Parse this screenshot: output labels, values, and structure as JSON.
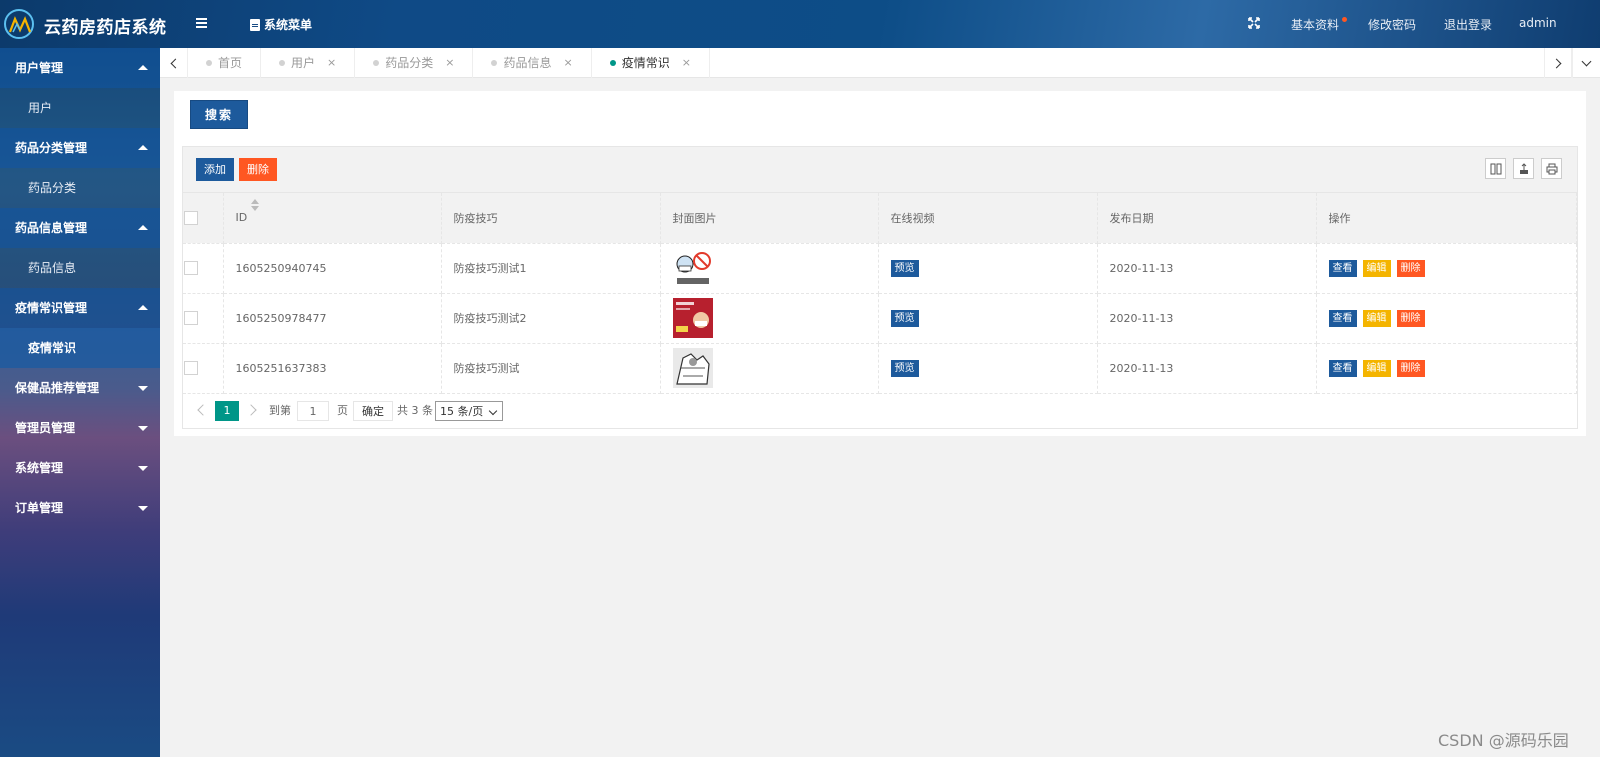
{
  "header": {
    "app_title": "云药房药店系统",
    "system_menu": "系统菜单",
    "basic_info": "基本资料",
    "change_password": "修改密码",
    "logout": "退出登录",
    "user": "admin"
  },
  "sidebar": {
    "groups": [
      {
        "label": "用户管理",
        "sub": "用户"
      },
      {
        "label": "药品分类管理",
        "sub": "药品分类"
      },
      {
        "label": "药品信息管理",
        "sub": "药品信息"
      },
      {
        "label": "疫情常识管理",
        "sub": "疫情常识"
      },
      {
        "label": "保健品推荐管理"
      },
      {
        "label": "管理员管理"
      },
      {
        "label": "系统管理"
      },
      {
        "label": "订单管理"
      }
    ]
  },
  "tabs": [
    {
      "label": "首页"
    },
    {
      "label": "用户"
    },
    {
      "label": "药品分类"
    },
    {
      "label": "药品信息"
    },
    {
      "label": "疫情常识"
    }
  ],
  "tab_close": "×",
  "search_button": "搜索",
  "toolbar": {
    "add": "添加",
    "delete": "删除"
  },
  "table": {
    "headers": [
      "ID",
      "防疫技巧",
      "封面图片",
      "在线视频",
      "发布日期",
      "操作"
    ],
    "rows": [
      {
        "id": "1605250940745",
        "title": "防疫技巧测试1",
        "video": "预览",
        "date": "2020-11-13"
      },
      {
        "id": "1605250978477",
        "title": "防疫技巧测试2",
        "video": "预览",
        "date": "2020-11-13"
      },
      {
        "id": "1605251637383",
        "title": "防疫技巧测试",
        "video": "预览",
        "date": "2020-11-13"
      }
    ],
    "actions": {
      "view": "查看",
      "edit": "编辑",
      "delete": "删除"
    }
  },
  "pager": {
    "current": "1",
    "goto_label": "到第",
    "page_input": "1",
    "page_unit": "页",
    "confirm": "确定",
    "total": "共 3 条",
    "page_size": "15 条/页"
  },
  "watermark": "CSDN @源码乐园",
  "colors": {
    "primary": "#1d5a9c",
    "danger": "#ff5722",
    "warning": "#f4b400",
    "teal": "#009688"
  }
}
